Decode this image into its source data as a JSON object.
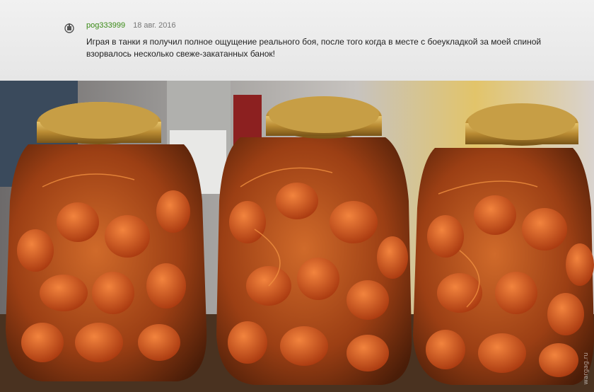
{
  "comment": {
    "username": "pog333999",
    "date": "18 авг. 2016",
    "text": "Играя в танки я получил полное ощущение реального боя, после того когда в месте с боеукладкой за моей спиной взорвалось несколько свеже-закатанных банок!",
    "icon": "tank-icon"
  },
  "photo": {
    "watermark": "wargag.ru",
    "jar_count": 3
  }
}
